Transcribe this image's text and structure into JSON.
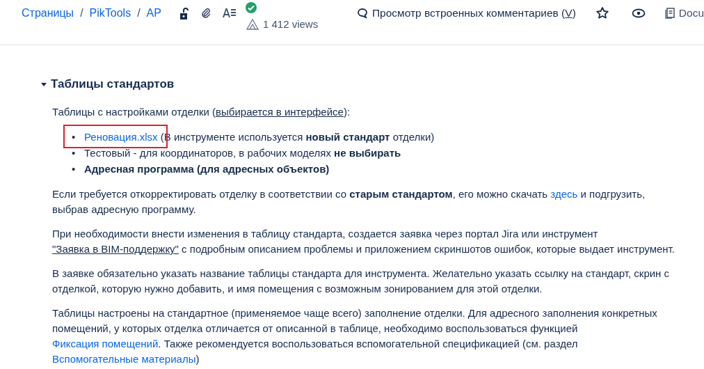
{
  "breadcrumbs": [
    "Страницы",
    "PikTools",
    "AP"
  ],
  "breadcrumb_separator": "/",
  "views": "1 412 views",
  "toolbar": {
    "comments": {
      "label": "Просмотр встроенных комментариев (",
      "key": "V",
      "end": ")"
    },
    "docs": "Docu"
  },
  "section": {
    "title": "Таблицы стандартов",
    "expanded": true,
    "intro": [
      {
        "kind": "text",
        "text": "Таблицы с настройками отделки ("
      },
      {
        "kind": "ulink",
        "text": "выбирается в интерфейсе"
      },
      {
        "kind": "text",
        "text": "):"
      }
    ],
    "bullets": [
      {
        "marker": "•",
        "highlighted": true,
        "segments": [
          {
            "kind": "link",
            "text": "Реновация.xlsx"
          },
          {
            "kind": "text",
            "text": " (В инструменте используется "
          },
          {
            "kind": "bold",
            "text": "новый стандарт"
          },
          {
            "kind": "text",
            "text": " отделки)"
          }
        ]
      },
      {
        "marker": "•",
        "highlighted": false,
        "segments": [
          {
            "kind": "text",
            "text": "Тестовый - для координаторов, в рабочих моделях "
          },
          {
            "kind": "bold",
            "text": "не выбирать"
          }
        ]
      },
      {
        "marker": "•",
        "highlighted": false,
        "segments": [
          {
            "kind": "bold",
            "text": "Адресная программа (для адресных объектов)"
          }
        ]
      }
    ],
    "paragraphs": [
      [
        {
          "kind": "text",
          "text": "Если требуется откорректировать отделку в соответствии со "
        },
        {
          "kind": "bold",
          "text": "старым стандартом"
        },
        {
          "kind": "text",
          "text": ", его можно скачать "
        },
        {
          "kind": "link",
          "text": "здесь"
        },
        {
          "kind": "text",
          "text": " и подгрузить, выбрав адресную программу."
        }
      ],
      [
        {
          "kind": "text",
          "text": "При необходимости внести изменения в таблицу стандарта, создается заявка через портал Jira или инструмент "
        },
        {
          "kind": "ulink",
          "text": "\"Заявка в BIM-поддержку\""
        },
        {
          "kind": "text",
          "text": " с подробным описанием проблемы и приложением скриншотов ошибок, которые выдает инструмент."
        }
      ],
      [
        {
          "kind": "text",
          "text": "В заявке обязательно указать название таблицы стандарта для инструмента. Желательно указать ссылку на стандарт, скрин с отделкой, которую нужно добавить, и имя помещения с возможным зонированием для этой отделки."
        }
      ],
      [
        {
          "kind": "text",
          "text": "Таблицы настроены на стандартное (применяемое чаще всего) заполнение отделки. Для адресного заполнения конкретных помещений, у которых отделка отличается от описанной в таблице, необходимо воспользоваться функцией "
        },
        {
          "kind": "link",
          "text": "Фиксация помещений"
        },
        {
          "kind": "text",
          "text": ". Также рекомендуется воспользоваться вспомогательной спецификацией (см. раздел "
        },
        {
          "kind": "link",
          "text": "Вспомогательные материалы"
        },
        {
          "kind": "text",
          "text": ")"
        }
      ]
    ]
  }
}
